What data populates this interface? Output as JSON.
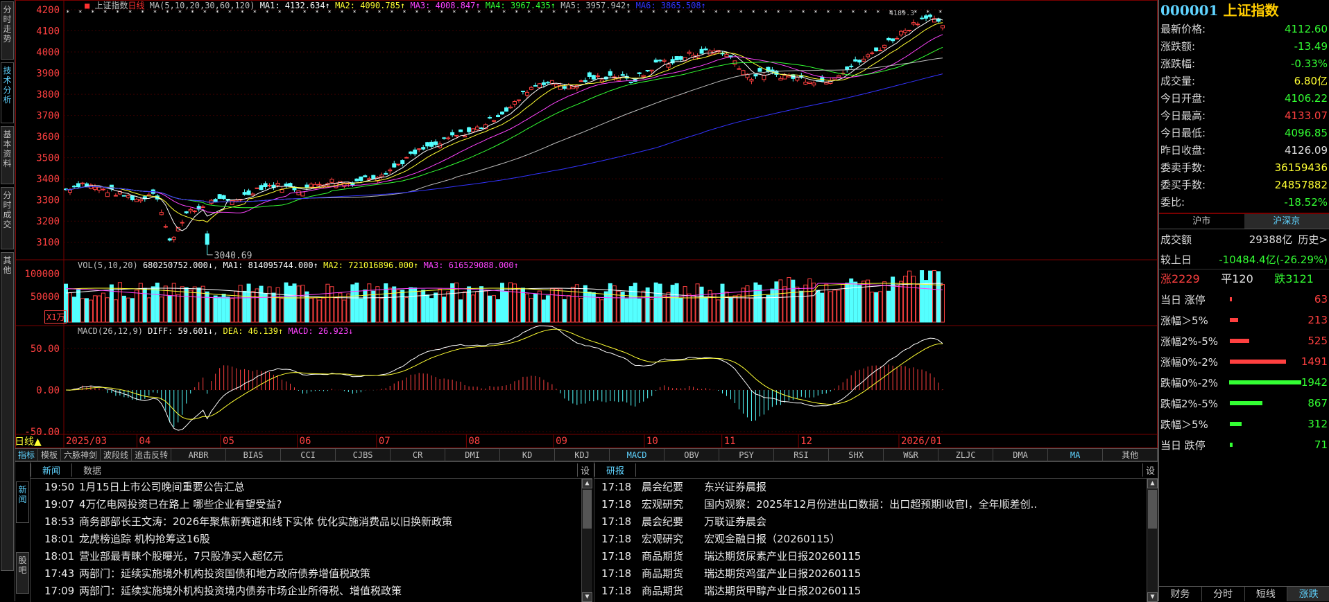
{
  "left_tabs": [
    "分时走势",
    "技术分析",
    "基本资料",
    "分时成交",
    "其他"
  ],
  "chart_header": {
    "marker": "■",
    "name": "上证指数",
    "period": "日线",
    "ma_text": "MA(5,10,20,30,60,120)",
    "ma1": "MA1: 4132.634↑",
    "ma2": "MA2: 4090.785↑",
    "ma3": "MA3: 4008.847↑",
    "ma4": "MA4: 3967.435↑",
    "ma5": "MA5: 3957.942↑",
    "ma6": "MA6: 3865.508↑"
  },
  "vol_header": {
    "params": "VOL(5,10,20)",
    "value": "680250752.000↓",
    "ma1": "MA1: 814095744.000↑",
    "ma2": "MA2: 721016896.000↑",
    "ma3": "MA3: 616529088.000↑"
  },
  "macd_header": {
    "params": "MACD(26,12,9)",
    "diff": "DIFF: 59.601↓",
    "dea": "DEA: 46.139↑",
    "macd": "MACD: 26.923↓"
  },
  "period_label": "日线▲",
  "unit_label": "X1万",
  "price_axis": [
    "4200",
    "4100",
    "4000",
    "3900",
    "3800",
    "3700",
    "3600",
    "3500",
    "3400",
    "3300",
    "3200",
    "3100"
  ],
  "vol_axis": [
    "100000",
    "50000"
  ],
  "macd_axis": [
    "50.00",
    "0.00",
    "-50.00"
  ],
  "month_labels": [
    "2025/03",
    "04",
    "05",
    "06",
    "07",
    "08",
    "09",
    "10",
    "11",
    "12",
    "2026/01"
  ],
  "annotations": {
    "low": "3040.69",
    "high": "4189.3"
  },
  "indicator_tabs": [
    "指标",
    "模板",
    "六脉神剑",
    "波段线",
    "追击反转",
    "ARBR",
    "BIAS",
    "CCI",
    "CJBS",
    "CR",
    "DMI",
    "KD",
    "KDJ",
    "MACD",
    "OBV",
    "PSY",
    "RSI",
    "SHX",
    "W&R",
    "ZLJC",
    "DMA",
    "MA",
    "其他"
  ],
  "news": {
    "side_tabs": [
      "新闻",
      "股吧"
    ],
    "head_tabs": [
      "新闻",
      "数据",
      "设"
    ],
    "rows": [
      {
        "time": "19:50",
        "title": "1月15日上市公司晚间重要公告汇总"
      },
      {
        "time": "19:07",
        "title": "4万亿电网投资已在路上 哪些企业有望受益?"
      },
      {
        "time": "18:53",
        "title": "商务部部长王文涛：2026年聚焦新赛道和线下实体 优化实施消费品以旧换新政策"
      },
      {
        "time": "18:01",
        "title": "龙虎榜追踪 机构抢筹这16股"
      },
      {
        "time": "18:01",
        "title": "营业部最青睐个股曝光，7只股净买入超亿元"
      },
      {
        "time": "17:43",
        "title": "两部门：延续实施境外机构投资国债和地方政府债券增值税政策"
      },
      {
        "time": "17:09",
        "title": "两部门：延续实施境外机构投资境内债券市场企业所得税、增值税政策"
      }
    ]
  },
  "research": {
    "head_tabs": [
      "研报",
      "设"
    ],
    "rows": [
      {
        "time": "17:18",
        "cat": "晨会纪要",
        "title": "东兴证券晨报"
      },
      {
        "time": "17:18",
        "cat": "宏观研究",
        "title": "国内观察：2025年12月份进出口数据：出口超预期l收官l，全年顺差创.."
      },
      {
        "time": "17:18",
        "cat": "晨会纪要",
        "title": "万联证券晨会"
      },
      {
        "time": "17:18",
        "cat": "宏观研究",
        "title": "宏观金融日报（20260115）"
      },
      {
        "time": "17:18",
        "cat": "商品期货",
        "title": "瑞达期货尿素产业日报20260115"
      },
      {
        "time": "17:18",
        "cat": "商品期货",
        "title": "瑞达期货鸡蛋产业日报20260115"
      },
      {
        "time": "17:18",
        "cat": "商品期货",
        "title": "瑞达期货甲醇产业日报20260115"
      }
    ]
  },
  "quote": {
    "code": "000001",
    "name": "上证指数",
    "rows": [
      {
        "k": "最新价格:",
        "v": "4112.60",
        "c": "g"
      },
      {
        "k": "涨跌额:",
        "v": "-13.49",
        "c": "g"
      },
      {
        "k": "涨跌幅:",
        "v": "-0.33%",
        "c": "g"
      },
      {
        "k": "成交量:",
        "v": "6.80亿",
        "c": "y"
      },
      {
        "k": "今日开盘:",
        "v": "4106.22",
        "c": "g"
      },
      {
        "k": "今日最高:",
        "v": "4133.07",
        "c": "r"
      },
      {
        "k": "今日最低:",
        "v": "4096.85",
        "c": "g"
      },
      {
        "k": "昨日收盘:",
        "v": "4126.09",
        "c": "w"
      },
      {
        "k": "委卖手数:",
        "v": "36159436",
        "c": "y"
      },
      {
        "k": "委买手数:",
        "v": "24857882",
        "c": "y"
      },
      {
        "k": "委比:",
        "v": "-18.52%",
        "c": "g"
      }
    ]
  },
  "market_tabs": [
    "沪市",
    "沪深京"
  ],
  "turnover": {
    "k": "成交额",
    "v": "29388亿",
    "h": "历史>"
  },
  "prev": {
    "k": "较上日",
    "v": "-10484.4亿(-26.29%)"
  },
  "breadth": {
    "up": "涨2229",
    "flat": "平120",
    "down": "跌3121"
  },
  "dist": [
    {
      "label": "当日 涨停",
      "value": "63",
      "frac": 0.03,
      "color": "#ff4040"
    },
    {
      "label": "涨幅＞5%",
      "value": "213",
      "frac": 0.11,
      "color": "#ff4040"
    },
    {
      "label": "涨幅2%-5%",
      "value": "525",
      "frac": 0.27,
      "color": "#ff4040"
    },
    {
      "label": "涨幅0%-2%",
      "value": "1491",
      "frac": 0.77,
      "color": "#ff4040"
    },
    {
      "label": "跌幅0%-2%",
      "value": "1942",
      "frac": 1.0,
      "color": "#33ff33"
    },
    {
      "label": "跌幅2%-5%",
      "value": "867",
      "frac": 0.45,
      "color": "#33ff33"
    },
    {
      "label": "跌幅＞5%",
      "value": "312",
      "frac": 0.16,
      "color": "#33ff33"
    },
    {
      "label": "当日 跌停",
      "value": "71",
      "frac": 0.04,
      "color": "#33ff33"
    }
  ],
  "bottom_tabs": [
    "财务",
    "分时",
    "短线",
    "涨跌"
  ],
  "chart_data": {
    "type": "candlestick",
    "title": "上证指数 日线",
    "ylim": [
      3040,
      4200
    ],
    "low": 3040.69,
    "high": 4189.3,
    "x": [
      "2025/03",
      "04",
      "05",
      "06",
      "07",
      "08",
      "09",
      "10",
      "11",
      "12",
      "2026/01"
    ],
    "close_trend": [
      3350,
      3380,
      3360,
      3340,
      3320,
      3300,
      3350,
      3100,
      3230,
      3260,
      3300,
      3290,
      3320,
      3360,
      3370,
      3360,
      3350,
      3380,
      3390,
      3380,
      3400,
      3420,
      3450,
      3500,
      3540,
      3560,
      3600,
      3620,
      3650,
      3700,
      3740,
      3820,
      3860,
      3850,
      3830,
      3870,
      3880,
      3890,
      3860,
      3900,
      3960,
      3950,
      3990,
      4000,
      4010,
      3960,
      3880,
      3900,
      3890,
      3880,
      3870,
      3860,
      3900,
      3940,
      3980,
      4030,
      4080,
      4130,
      4180,
      4112
    ]
  }
}
